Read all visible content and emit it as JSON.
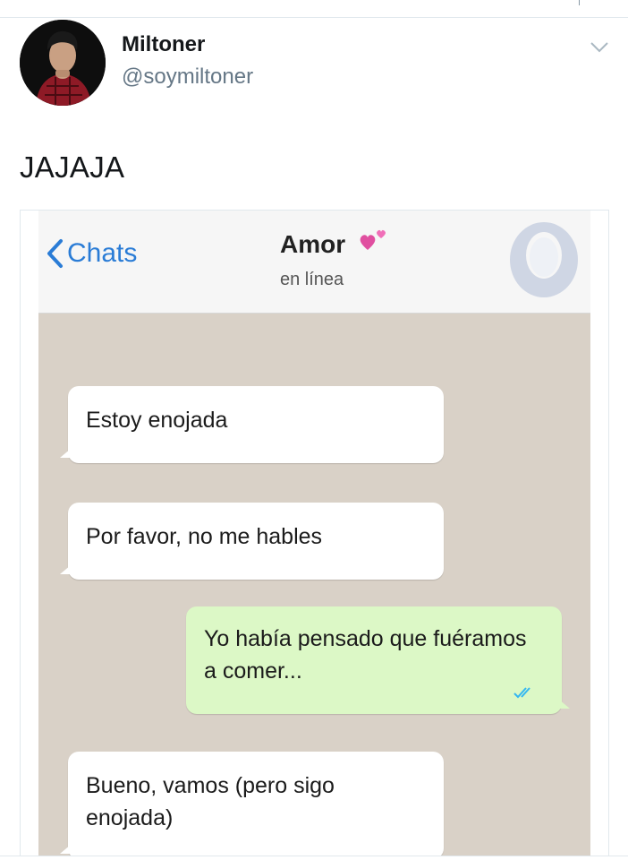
{
  "tweet": {
    "display_name": "Miltoner",
    "handle": "@soymiltoner",
    "text": "JAJAJA"
  },
  "chat": {
    "back_label": "Chats",
    "contact_name": "Amor",
    "status": "en línea",
    "messages": [
      {
        "direction": "incoming",
        "text": "Estoy enojada"
      },
      {
        "direction": "incoming",
        "text": "Por favor, no me hables"
      },
      {
        "direction": "outgoing",
        "text": "Yo había pensado que fuéramos a comer...",
        "read": true
      },
      {
        "direction": "incoming",
        "text": "Bueno, vamos (pero sigo enojada)"
      }
    ]
  },
  "colors": {
    "link_blue": "#2a7cd6",
    "outgoing_bubble": "#dcf8c6",
    "chat_background": "#d9d1c7",
    "hearts": "#e04fa0",
    "read_ticks": "#34b7f1"
  },
  "icons": {
    "chevron": "chevron-down-icon",
    "back": "chevron-left-icon",
    "hearts": "two-hearts-icon",
    "read_receipt": "double-check-icon",
    "contact": "default-avatar-icon"
  }
}
